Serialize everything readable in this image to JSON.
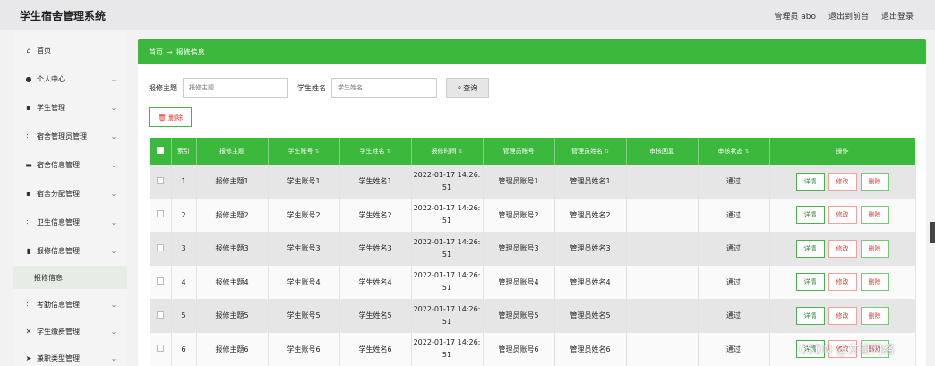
{
  "header": {
    "title": "学生宿舍管理系统",
    "links": [
      "管理员 abo",
      "退出到前台",
      "退出登录"
    ]
  },
  "sidebar": {
    "items": [
      {
        "label": "首页",
        "icon": "home-icon",
        "glyph": "⌂",
        "arrow": ""
      },
      {
        "label": "个人中心",
        "icon": "user-icon",
        "glyph": "●",
        "arrow": "⌄"
      },
      {
        "label": "学生管理",
        "icon": "doc-icon",
        "glyph": "▪",
        "arrow": "⌄"
      },
      {
        "label": "宿舍管理员管理",
        "icon": "grid-icon",
        "glyph": "∷",
        "arrow": "⌄"
      },
      {
        "label": "宿舍信息管理",
        "icon": "building-icon",
        "glyph": "▬",
        "arrow": "⌄"
      },
      {
        "label": "宿舍分配管理",
        "icon": "doc-icon",
        "glyph": "▪",
        "arrow": "⌄"
      },
      {
        "label": "卫生信息管理",
        "icon": "grid-icon",
        "glyph": "∷",
        "arrow": "⌄"
      },
      {
        "label": "报修信息管理",
        "icon": "bar-chart-icon",
        "glyph": "▮",
        "arrow": "⌄"
      },
      {
        "label": "报修信息",
        "icon": "",
        "glyph": "",
        "arrow": ""
      },
      {
        "label": "考勤信息管理",
        "icon": "grid-icon",
        "glyph": "∷",
        "arrow": "⌄"
      },
      {
        "label": "学生缴费管理",
        "icon": "money-icon",
        "glyph": "✕",
        "arrow": "⌄"
      },
      {
        "label": "兼职类型管理",
        "icon": "send-icon",
        "glyph": "➤",
        "arrow": "⌄"
      }
    ]
  },
  "breadcrumb": {
    "home": "首页",
    "sep": "→",
    "current": "报修信息"
  },
  "search": {
    "label1": "报修主题",
    "placeholder1": "报修主题",
    "label2": "学生姓名",
    "placeholder2": "学生姓名",
    "button": "查询"
  },
  "toolbar": {
    "delete_label": "删除"
  },
  "table": {
    "headers": [
      "索引",
      "报修主题",
      "学生账号",
      "学生姓名",
      "报修时间",
      "管理员账号",
      "管理员姓名",
      "审核回复",
      "审核状态",
      "操作"
    ],
    "ops": {
      "detail": "详情",
      "edit": "修改",
      "delete": "删除"
    },
    "rows": [
      [
        "1",
        "报修主题1",
        "学生账号1",
        "学生姓名1",
        "2022-01-17 14:26:",
        "51",
        "管理员账号1",
        "管理员姓名1",
        "",
        "通过"
      ],
      [
        "2",
        "报修主题2",
        "学生账号2",
        "学生姓名2",
        "2022-01-17 14:26:",
        "51",
        "管理员账号2",
        "管理员姓名2",
        "",
        "通过"
      ],
      [
        "3",
        "报修主题3",
        "学生账号3",
        "学生姓名3",
        "2022-01-17 14:26:",
        "51",
        "管理员账号3",
        "管理员姓名3",
        "",
        "通过"
      ],
      [
        "4",
        "报修主题4",
        "学生账号4",
        "学生姓名4",
        "2022-01-17 14:26:",
        "51",
        "管理员账号4",
        "管理员姓名4",
        "",
        "通过"
      ],
      [
        "5",
        "报修主题5",
        "学生账号5",
        "学生姓名5",
        "2022-01-17 14:26:",
        "51",
        "管理员账号5",
        "管理员姓名5",
        "",
        "通过"
      ],
      [
        "6",
        "报修主题6",
        "学生账号6",
        "学生姓名6",
        "2022-01-17 14:26:",
        "51",
        "管理员账号6",
        "管理员姓名6",
        "",
        "通过"
      ]
    ]
  },
  "watermark": "CSDN @文哥网络",
  "colors": {
    "accent": "#3cb83c",
    "danger": "#e53935"
  }
}
